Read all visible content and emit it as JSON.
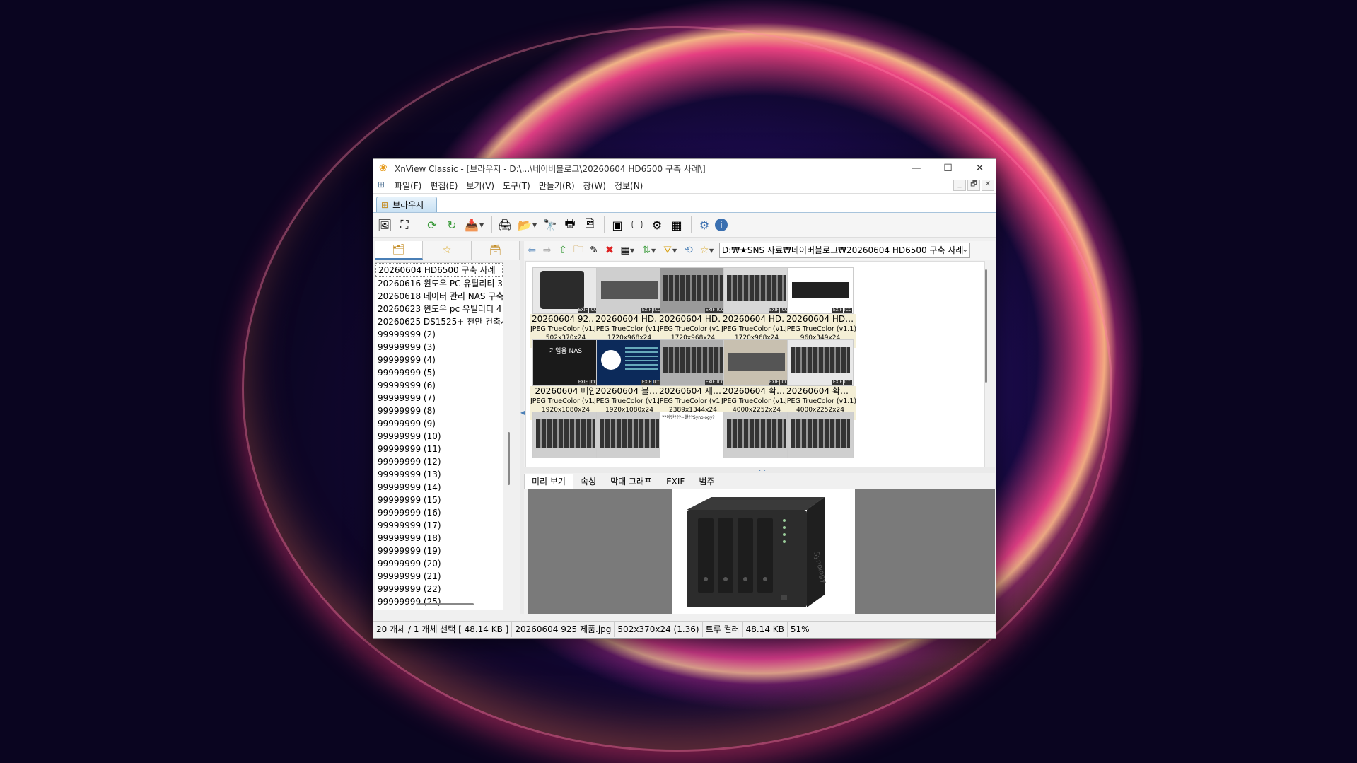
{
  "window": {
    "title": "XnView Classic - [브라우저 - D:\\...\\네이버블로그\\20260604 HD6500 구축 사례\\]",
    "minimize": "—",
    "maximize": "☐",
    "close": "✕"
  },
  "menu": [
    "파일(F)",
    "편집(E)",
    "보기(V)",
    "도구(T)",
    "만들기(R)",
    "창(W)",
    "정보(N)"
  ],
  "mdi_controls": [
    "_",
    "🗗",
    "✕"
  ],
  "browser_tab": "브라우저",
  "address": "D:₩★SNS 자료₩네이버블로그₩20260604 HD6500 구축 사례",
  "folders": [
    "20260604 HD6500 구축 사례",
    "20260616 윈도우 PC 유틸리티 3",
    "20260618 데이터 관리 NAS 구축",
    "20260623 윈도우 pc 유틸리티 4",
    "20260625 DS1525+ 천안 건축사",
    "99999999 (2)",
    "99999999 (3)",
    "99999999 (4)",
    "99999999 (5)",
    "99999999 (6)",
    "99999999 (7)",
    "99999999 (8)",
    "99999999 (9)",
    "99999999 (10)",
    "99999999 (11)",
    "99999999 (12)",
    "99999999 (13)",
    "99999999 (14)",
    "99999999 (15)",
    "99999999 (16)",
    "99999999 (17)",
    "99999999 (18)",
    "99999999 (19)",
    "99999999 (20)",
    "99999999 (21)",
    "99999999 (22)",
    "99999999 (25)",
    "99999999 (26)"
  ],
  "thumbnails": [
    {
      "name": "20260604 925 ...",
      "format": "JPEG TrueColor (v1.1)",
      "dims": "502x370x24"
    },
    {
      "name": "20260604 HD6...",
      "format": "JPEG TrueColor (v1.1)",
      "dims": "1720x968x24"
    },
    {
      "name": "20260604 HD6...",
      "format": "JPEG TrueColor (v1.1)",
      "dims": "1720x968x24"
    },
    {
      "name": "20260604 HD6...",
      "format": "JPEG TrueColor (v1.1)",
      "dims": "1720x968x24"
    },
    {
      "name": "20260604 HD6...",
      "format": "JPEG TrueColor (v1.1)",
      "dims": "960x349x24"
    },
    {
      "name": "20260604 메인",
      "format": "JPEG TrueColor (v1.1)",
      "dims": "1920x1080x24"
    },
    {
      "name": "20260604 블로그",
      "format": "JPEG TrueColor (v1.1)",
      "dims": "1920x1080x24"
    },
    {
      "name": "20260604 제목...",
      "format": "JPEG TrueColor (v1.1)",
      "dims": "2389x1344x24"
    },
    {
      "name": "20260604 확장...",
      "format": "JPEG TrueColor (v1.1)",
      "dims": "4000x2252x24"
    },
    {
      "name": "20260604 확장...",
      "format": "JPEG TrueColor (v1.1)",
      "dims": "4000x2252x24"
    }
  ],
  "thumb_tags": {
    "exif": "EXIF",
    "icc": "ICC"
  },
  "thumb_texts": {
    "main": "기업용 NAS",
    "third_row_text": "??이란???~할??Synology?"
  },
  "preview_tabs": [
    "미리 보기",
    "속성",
    "막대 그래프",
    "EXIF",
    "범주"
  ],
  "preview_brand": "Synology",
  "status": {
    "count": "20 개체 / 1 개체 선택  [ 48.14 KB ]",
    "file": "20260604 925 제품.jpg",
    "dims": "502x370x24 (1.36)",
    "color": "트루 컬러",
    "size": "48.14 KB",
    "zoom": "51%"
  },
  "colors": {
    "accent": "#4a7fb6",
    "caption_bg": "#f4efd6"
  }
}
